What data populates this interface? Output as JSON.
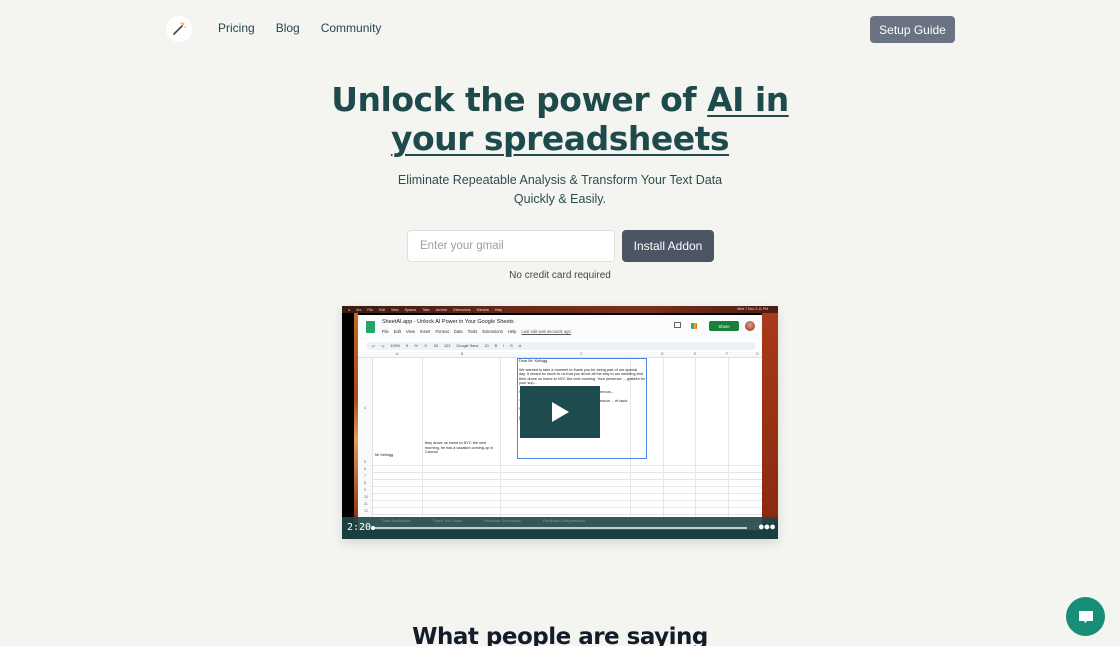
{
  "nav": {
    "logo_icon": "magic-wand-icon",
    "links": [
      {
        "label": "Pricing"
      },
      {
        "label": "Blog"
      },
      {
        "label": "Community"
      }
    ],
    "setup_guide_label": "Setup Guide"
  },
  "hero": {
    "title_plain": "Unlock the power of ",
    "title_underlined_1": "AI in",
    "title_underlined_2": "your spreadsheets",
    "subtitle_line1": "Eliminate Repeatable Analysis & Transform Your Text Data",
    "subtitle_line2": "Quickly & Easily.",
    "email_placeholder": "Enter your gmail",
    "email_value": "",
    "install_label": "Install Addon",
    "note": "No credit card required"
  },
  "video": {
    "mac_menu": [
      "Arc",
      "File",
      "Edit",
      "View",
      "Spaces",
      "Tabs",
      "Archive",
      "Extensions",
      "Window",
      "Help"
    ],
    "mac_clock": "Wed 7 Dec 2:11 PM",
    "sheet": {
      "doc_title": "SheetAI.app - Unlock AI Power in Your Google Sheets",
      "menu": [
        "File",
        "Edit",
        "View",
        "Insert",
        "Format",
        "Data",
        "Tools",
        "Extensions",
        "Help"
      ],
      "last_edit": "Last edit was seconds ago",
      "share_label": "Share",
      "toolbar": [
        "100%",
        "€",
        "%",
        ".0",
        ".00",
        "123",
        "Google Sans",
        "10",
        "B",
        "I",
        "S",
        "A"
      ],
      "columns": [
        "A",
        "B",
        "C",
        "D",
        "E",
        "F",
        "G"
      ],
      "rows": [
        "4",
        "5",
        "6",
        "7",
        "8",
        "9",
        "10",
        "11",
        "12"
      ],
      "cell_a4": "Mr Kellogg",
      "cell_b4": "they drove us home to NYC the next morning, he has a vacation coming up in Cancun",
      "cell_c4": [
        "Dear Mr. Kellogg,",
        "",
        "We wanted to take a moment to thank you for being part of our special day. It meant so much to us that you drove all the way to our wedding and then drove us home to NYC the next morning. Your presence ... grateful for your sup...",
        "",
        "We also ... We are so excited t... n. It was so generous...",
        "",
        "Your frie... so thankful to have you... ul time in Cancun ... et back.",
        "",
        "With love and appreciation,",
        "",
        "[Names]"
      ],
      "tabs": [
        "Data Sanitization",
        "Thank You Cards",
        "Feedback Summaries",
        "Feedback Categorisation"
      ]
    },
    "time": "2:20",
    "progress": 0.0,
    "play_icon": "play-icon",
    "more_icon": "more-options-icon"
  },
  "testimonials": {
    "title": "What people are saying"
  },
  "chat": {
    "icon": "chat-bubble-icon"
  }
}
